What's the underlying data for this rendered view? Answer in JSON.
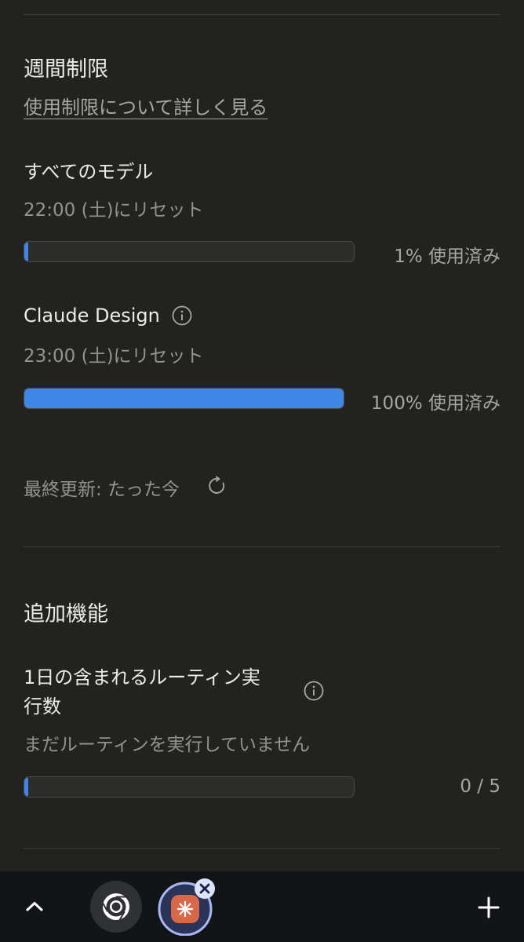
{
  "weekly": {
    "title": "週間制限",
    "learn_more_link": "使用制限について詳しく見る",
    "items": [
      {
        "name": "すべてのモデル",
        "reset": "22:00 (土)にリセット",
        "usage_percent": 1,
        "usage_label": "1% 使用済み"
      },
      {
        "name": "Claude Design",
        "reset": "23:00 (土)にリセット",
        "usage_percent": 100,
        "usage_label": "100% 使用済み"
      }
    ],
    "last_updated": "最終更新: たった今"
  },
  "extras": {
    "title": "追加機能",
    "routine": {
      "name": "1日の含まれるルーティン実\n行数",
      "status": "まだルーティンを実行していません",
      "used": 0,
      "limit": 5,
      "count_label": "0 / 5"
    }
  },
  "colors": {
    "accent": "#3f86e6",
    "background": "#222221",
    "taskbar": "#121417"
  },
  "taskbar": {
    "icons": [
      "chevron-up-icon",
      "chrome-icon",
      "claude-app-icon",
      "close-icon",
      "plus-icon"
    ]
  }
}
